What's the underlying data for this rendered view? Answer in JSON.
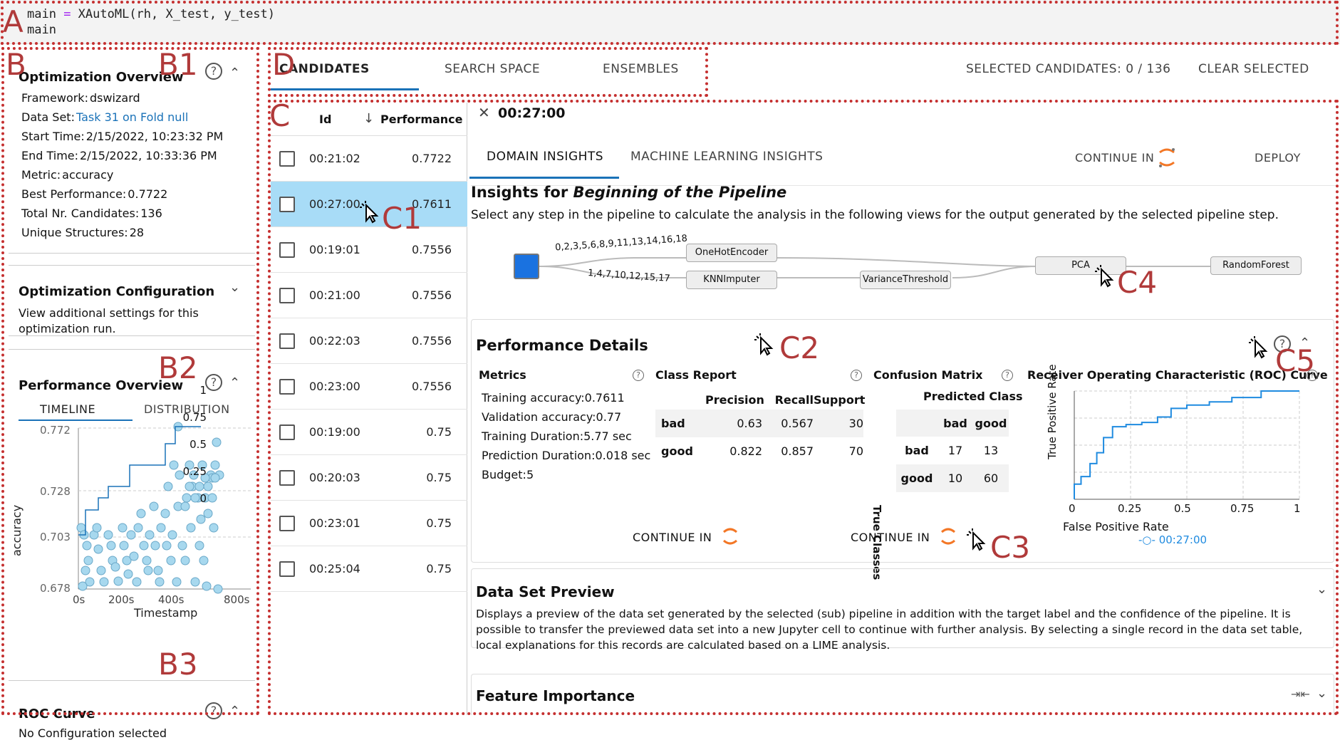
{
  "code": {
    "line1_pre": "main ",
    "line1_eq": "=",
    "line1_post": " XAutoML(rh, X_test, y_test)",
    "line2": "main"
  },
  "annotations": {
    "A": "A",
    "B": "B",
    "B1": "B1",
    "B2": "B2",
    "B3": "B3",
    "C": "C",
    "C1": "C1",
    "C2": "C2",
    "C3": "C3",
    "C4": "C4",
    "C5": "C5",
    "D": "D"
  },
  "overview": {
    "title": "Optimization Overview",
    "rows": [
      {
        "label": "Framework:",
        "value": "dswizard"
      },
      {
        "label": "Data Set:",
        "value": "Task 31 on Fold null"
      },
      {
        "label": "Start Time:",
        "value": "2/15/2022, 10:23:32 PM"
      },
      {
        "label": "End Time:",
        "value": "2/15/2022, 10:33:36 PM"
      },
      {
        "label": "Metric:",
        "value": "accuracy"
      },
      {
        "label": "Best Performance:",
        "value": "0.7722"
      },
      {
        "label": "Total Nr. Candidates:",
        "value": "136"
      },
      {
        "label": "Unique Structures:",
        "value": "28"
      }
    ]
  },
  "config": {
    "title": "Optimization Configuration",
    "description": "View additional settings for this optimization run."
  },
  "perf_overview": {
    "title": "Performance Overview",
    "tabs": [
      "TIMELINE",
      "DISTRIBUTION"
    ],
    "ylabel": "accuracy",
    "xlabel": "Timestamp",
    "yticks": [
      "0.772",
      "0.728",
      "0.703",
      "0.678"
    ],
    "xticks": [
      "0s",
      "200s",
      "400s",
      "800s"
    ]
  },
  "roc_side": {
    "title": "ROC Curve",
    "text": "No Configuration selected"
  },
  "top_tabs": {
    "tabs": [
      "CANDIDATES",
      "SEARCH SPACE",
      "ENSEMBLES"
    ],
    "selected_count": "SELECTED CANDIDATES: 0 / 136",
    "clear": "CLEAR SELECTED"
  },
  "candidates": {
    "headers": {
      "id": "Id",
      "perf": "Performance",
      "sort_icon": "↓"
    },
    "rows": [
      {
        "id": "00:21:02",
        "perf": "0.7722"
      },
      {
        "id": "00:27:00",
        "perf": "0.7611"
      },
      {
        "id": "00:19:01",
        "perf": "0.7556"
      },
      {
        "id": "00:21:00",
        "perf": "0.7556"
      },
      {
        "id": "00:22:03",
        "perf": "0.7556"
      },
      {
        "id": "00:23:00",
        "perf": "0.7556"
      },
      {
        "id": "00:19:00",
        "perf": "0.75"
      },
      {
        "id": "00:20:03",
        "perf": "0.75"
      },
      {
        "id": "00:23:01",
        "perf": "0.75"
      },
      {
        "id": "00:25:04",
        "perf": "0.75"
      }
    ]
  },
  "detail": {
    "close": "✕",
    "title": "00:27:00",
    "tabs": [
      "DOMAIN INSIGHTS",
      "MACHINE LEARNING INSIGHTS"
    ],
    "continue_in": "CONTINUE IN",
    "deploy": "DEPLOY",
    "insights_prefix": "Insights for ",
    "insights_em": "Beginning of the Pipeline",
    "insights_desc": "Select any step in the pipeline to calculate the analysis in the following views for the output generated by the selected pipeline step.",
    "pipeline": {
      "edge_top": "0,2,3,5,6,8,9,11,13,14,16,18",
      "edge_bottom": "1,4,7,10,12,15,17",
      "nodes": [
        "OneHotEncoder",
        "KNNImputer",
        "VarianceThreshold",
        "PCA",
        "RandomForest"
      ]
    }
  },
  "perf_details": {
    "title": "Performance Details",
    "metrics": {
      "title": "Metrics",
      "rows": [
        {
          "label": "Training accuracy:",
          "value": "0.7611"
        },
        {
          "label": "Validation accuracy:",
          "value": "0.77"
        },
        {
          "label": "Training Duration:",
          "value": "5.77 sec"
        },
        {
          "label": "Prediction Duration:",
          "value": "0.018 sec"
        },
        {
          "label": "Budget:",
          "value": "5"
        }
      ]
    },
    "class_report": {
      "title": "Class Report",
      "headers": [
        "",
        "Precision",
        "Recall",
        "Support"
      ],
      "rows": [
        [
          "bad",
          "0.63",
          "0.567",
          "30"
        ],
        [
          "good",
          "0.822",
          "0.857",
          "70"
        ]
      ]
    },
    "confusion": {
      "title": "Confusion Matrix",
      "predicted": "Predicted Class",
      "true": "True Classes",
      "cols": [
        "bad",
        "good"
      ],
      "rows": [
        [
          "bad",
          "17",
          "13"
        ],
        [
          "good",
          "10",
          "60"
        ]
      ]
    },
    "roc": {
      "title": "Receiver Operating Characteristic (ROC) Curve",
      "xlabel": "False Positive Rate",
      "ylabel": "True Positive Rate",
      "ticks": [
        "0",
        "0.25",
        "0.5",
        "0.75",
        "1"
      ],
      "legend": "00:27:00"
    },
    "continue_in": "CONTINUE IN"
  },
  "dataset_preview": {
    "title": "Data Set Preview",
    "text": "Displays a preview of the data set generated by the selected (sub) pipeline in addition with the target label and the confidence of the pipeline. It is possible to transfer the previewed data set into a new Jupyter cell to continue with further analysis. By selecting a single record in the data set table, local explanations for this records are calculated based on a LIME analysis."
  },
  "feature_importance": {
    "title": "Feature Importance"
  },
  "icons": {
    "help": "?",
    "caret_up": "⌃",
    "caret_down": "⌄"
  },
  "colors": {
    "accent": "#1a72b8",
    "selected_row": "#a8dcf7",
    "annotation": "#b03a3a",
    "scatter": "#a7d8ee"
  }
}
